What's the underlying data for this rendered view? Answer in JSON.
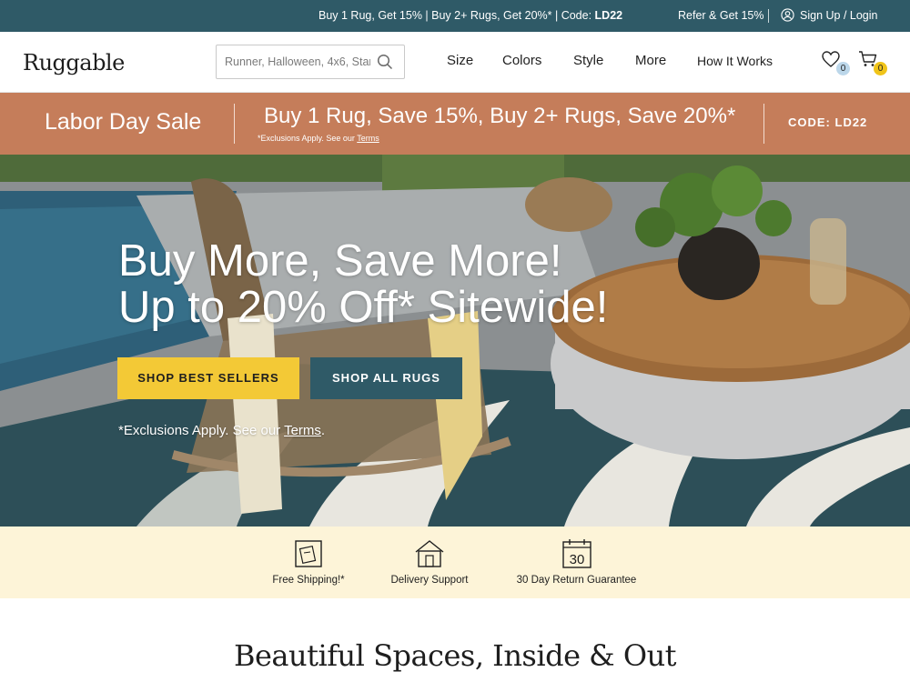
{
  "announcement": {
    "promo_prefix": "Buy 1 Rug, Get 15% | Buy 2+ Rugs, Get 20%* | Code: ",
    "promo_code": "LD22",
    "refer": "Refer & Get 15%",
    "login": "Sign Up / Login",
    "background": "#2f5a67"
  },
  "header": {
    "logo": "Ruggable",
    "search_placeholder": "Runner, Halloween, 4x6, Star",
    "nav": {
      "size": "Size",
      "colors": "Colors",
      "style": "Style",
      "more": "More",
      "how": "How It Works"
    },
    "wishlist_count": "0",
    "cart_count": "0",
    "icons": [
      "search-icon",
      "user-icon",
      "heart-icon",
      "cart-icon"
    ]
  },
  "sale_banner": {
    "title": "Labor Day Sale",
    "offer": "Buy 1 Rug, Save 15%, Buy 2+ Rugs, Save 20%*",
    "exclusions_prefix": "*Exclusions Apply. See our ",
    "exclusions_link": "Terms",
    "code": "CODE: LD22",
    "background": "#c57d5a"
  },
  "hero": {
    "headline_line1": "Buy More, Save More!",
    "headline_line2": "Up to 20% Off* Sitewide!",
    "button_best": "SHOP BEST SELLERS",
    "button_all": "SHOP ALL RUGS",
    "disclaimer_prefix": "*Exclusions Apply. See our ",
    "disclaimer_link": "Terms",
    "disclaimer_suffix": ".",
    "accent_yellow": "#f3c936",
    "accent_teal": "#2f5a67"
  },
  "perks": [
    {
      "label": "Free Shipping!*",
      "icon": "shipping-box-icon"
    },
    {
      "label": "Delivery Support",
      "icon": "house-icon"
    },
    {
      "label": "30 Day Return Guarantee",
      "icon": "calendar-icon",
      "calendar_number": "30"
    }
  ],
  "perks_background": "#fdf4d8",
  "section": {
    "title": "Beautiful Spaces, Inside & Out"
  }
}
